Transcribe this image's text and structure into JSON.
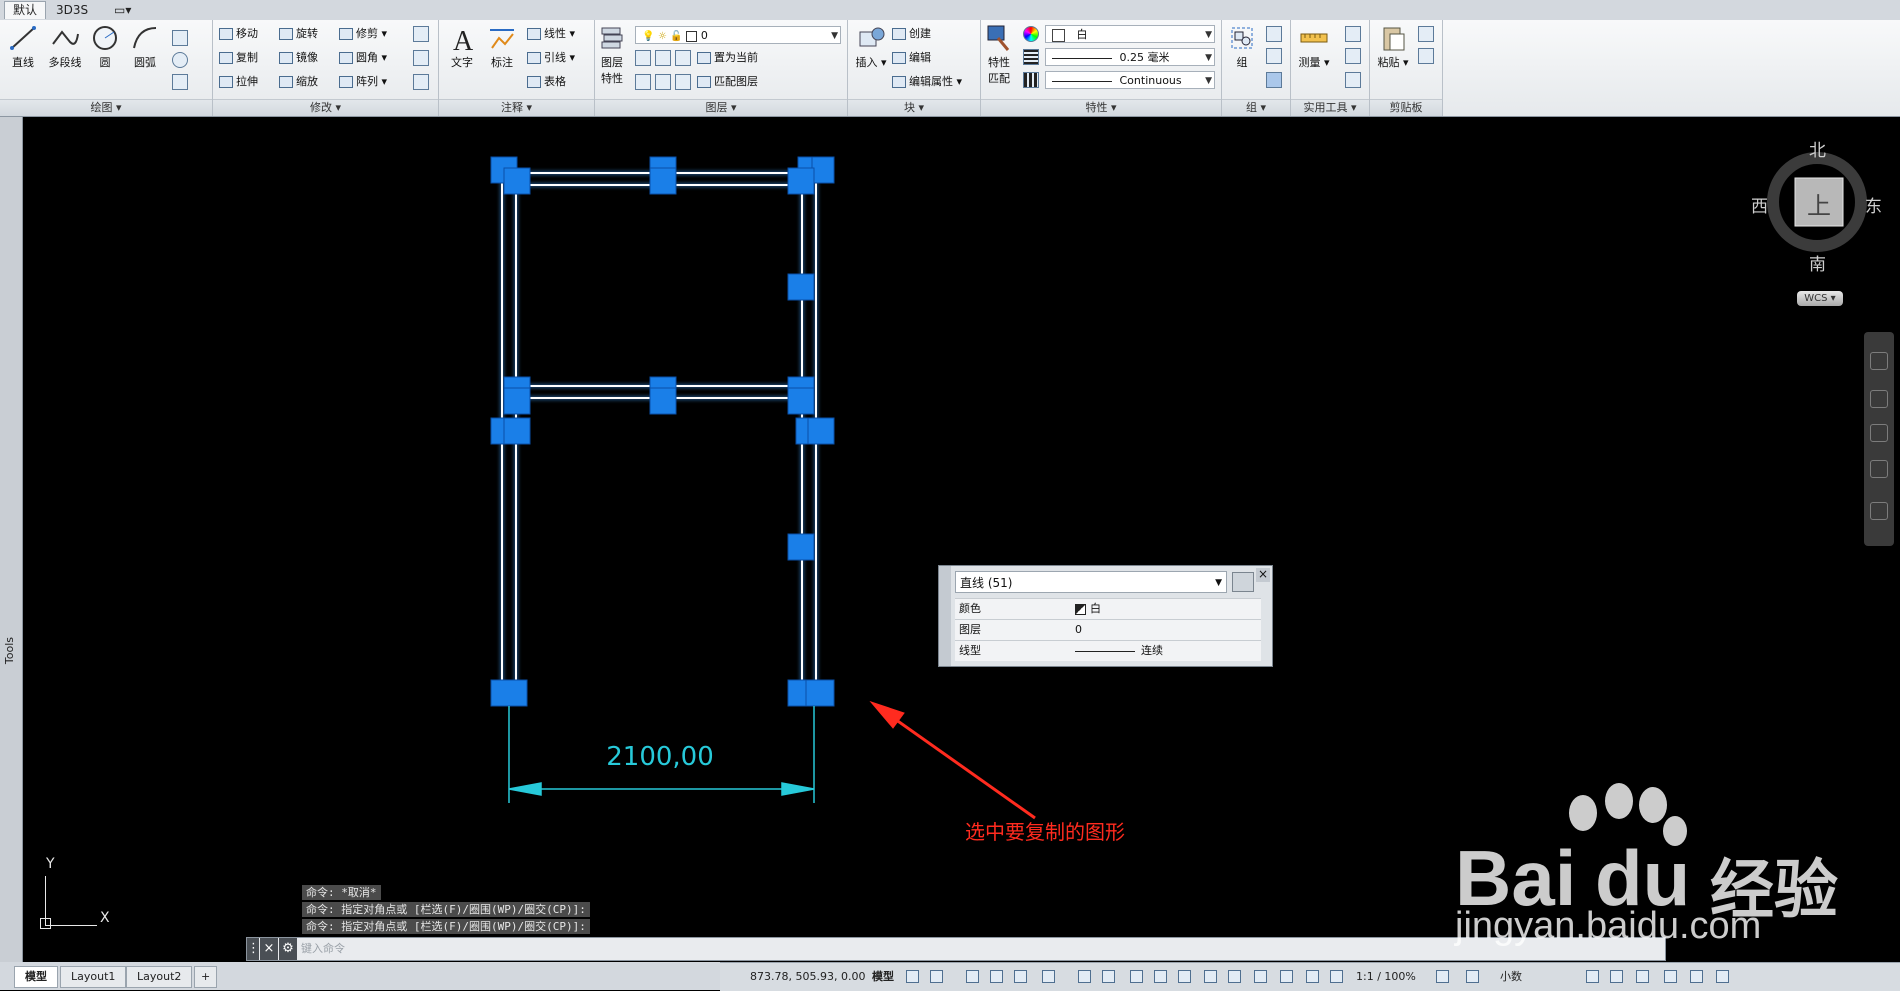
{
  "ribbon_tabs": [
    "默认",
    "3D3S"
  ],
  "ribbon": {
    "draw": {
      "title": "绘图",
      "line": "直线",
      "polyline": "多段线",
      "circle": "圆",
      "arc": "圆弧"
    },
    "modify": {
      "title": "修改",
      "move": "移动",
      "rotate": "旋转",
      "trim": "修剪",
      "copy": "复制",
      "mirror": "镜像",
      "fillet": "圆角",
      "stretch": "拉伸",
      "scale": "缩放",
      "array": "阵列"
    },
    "annotation": {
      "title": "注释",
      "text": "文字",
      "dim": "标注",
      "linear": "线性",
      "leader": "引线",
      "table": "表格"
    },
    "layers": {
      "title": "图层",
      "props": "图层特性",
      "props_l1": "图层",
      "props_l2": "特性",
      "current_layer": "0",
      "make_current": "置为当前",
      "match_layer": "匹配图层"
    },
    "block": {
      "title": "块",
      "insert": "插入",
      "create": "创建",
      "edit": "编辑",
      "edit_attr": "编辑属性"
    },
    "properties": {
      "title": "特性",
      "match": "特性匹配",
      "match_l1": "特性",
      "match_l2": "匹配",
      "color": "白",
      "lineweight": "0.25 毫米",
      "linetype": "Continuous"
    },
    "groups": {
      "title": "组",
      "group": "组"
    },
    "utilities": {
      "title": "实用工具",
      "measure": "测量"
    },
    "clipboard": {
      "title": "剪贴板",
      "paste": "粘贴"
    }
  },
  "left_palette": {
    "label": "Tools"
  },
  "viewcube": {
    "north": "北",
    "south": "南",
    "east": "东",
    "west": "西",
    "face": "上",
    "wcs": "WCS"
  },
  "quick_props": {
    "type": "直线 (51)",
    "rows": [
      {
        "key": "颜色",
        "value": "白"
      },
      {
        "key": "图层",
        "value": "0"
      },
      {
        "key": "线型",
        "value": "连续"
      }
    ]
  },
  "dimension_text": "2100,00",
  "annotation_text": "选中要复制的图形",
  "ucs": {
    "x": "X",
    "y": "Y"
  },
  "command_history": [
    "命令: *取消*",
    "命令: 指定对角点或 [栏选(F)/圈围(WP)/圈交(CP)]:",
    "命令: 指定对角点或 [栏选(F)/圈围(WP)/圈交(CP)]:"
  ],
  "command_input": {
    "placeholder": "键入命令"
  },
  "layout_tabs": [
    "模型",
    "Layout1",
    "Layout2",
    "+"
  ],
  "status": {
    "coords": "873.78, 505.93, 0.00",
    "space": "模型",
    "scale": "1:1 / 100%",
    "units": "小数"
  },
  "watermark": {
    "brand_left": "Bai",
    "brand_right": "du",
    "cn": "经验",
    "url": "jingyan.baidu.com"
  },
  "colors": {
    "selection_blue": "#1a7fe8",
    "dimension_cyan": "#27c9d9",
    "annotation_red": "#ff2b1f",
    "line_white": "#ffffff"
  }
}
